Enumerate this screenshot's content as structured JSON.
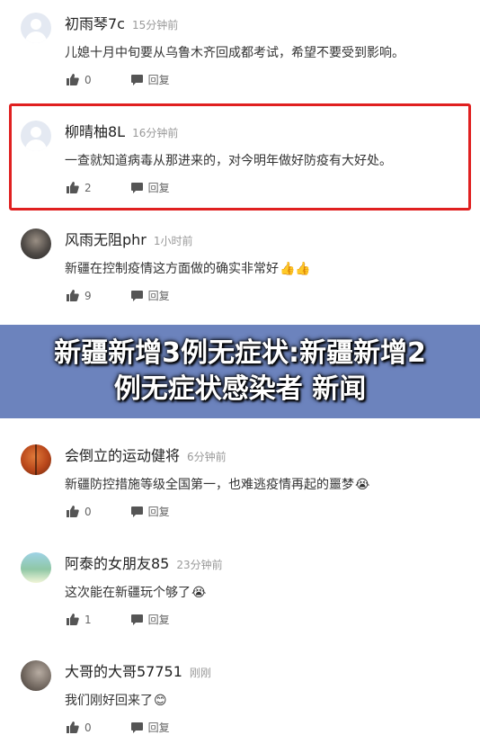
{
  "comments": [
    {
      "username": "初雨琴7c",
      "time": "15分钟前",
      "content": "儿媳十月中旬要从乌鲁木齐回成都考试，希望不要受到影响。",
      "emoji": "",
      "likes": "0",
      "reply": "回复",
      "avatar": "default-avatar"
    },
    {
      "username": "柳晴柚8L",
      "time": "16分钟前",
      "content": "一查就知道病毒从那进来的，对今明年做好防疫有大好处。",
      "emoji": "",
      "likes": "2",
      "reply": "回复",
      "avatar": "default-avatar"
    },
    {
      "username": "风雨无阻phr",
      "time": "1小时前",
      "content": "新疆在控制疫情这方面做的确实非常好",
      "emoji": "👍👍",
      "likes": "9",
      "reply": "回复",
      "avatar": "storm-avatar"
    },
    {
      "username": "会倒立的运动健将",
      "time": "6分钟前",
      "content": "新疆防控措施等级全国第一，也难逃疫情再起的噩梦",
      "emoji": "😭",
      "likes": "0",
      "reply": "回复",
      "avatar": "basketball-avatar"
    },
    {
      "username": "阿泰的女朋友85",
      "time": "23分钟前",
      "content": "这次能在新疆玩个够了",
      "emoji": "😭",
      "likes": "1",
      "reply": "回复",
      "avatar": "bridge-avatar"
    },
    {
      "username": "大哥的大哥57751",
      "time": "刚刚",
      "content": "我们刚好回来了",
      "emoji": "😊",
      "likes": "0",
      "reply": "回复",
      "avatar": "horse-avatar"
    }
  ],
  "banner": {
    "title": "新疆新增3例无症状:新疆新增2例无症状感染者 新闻"
  },
  "colors": {
    "highlight": "#e02020",
    "banner": "#5872b4",
    "muted": "#999999"
  }
}
